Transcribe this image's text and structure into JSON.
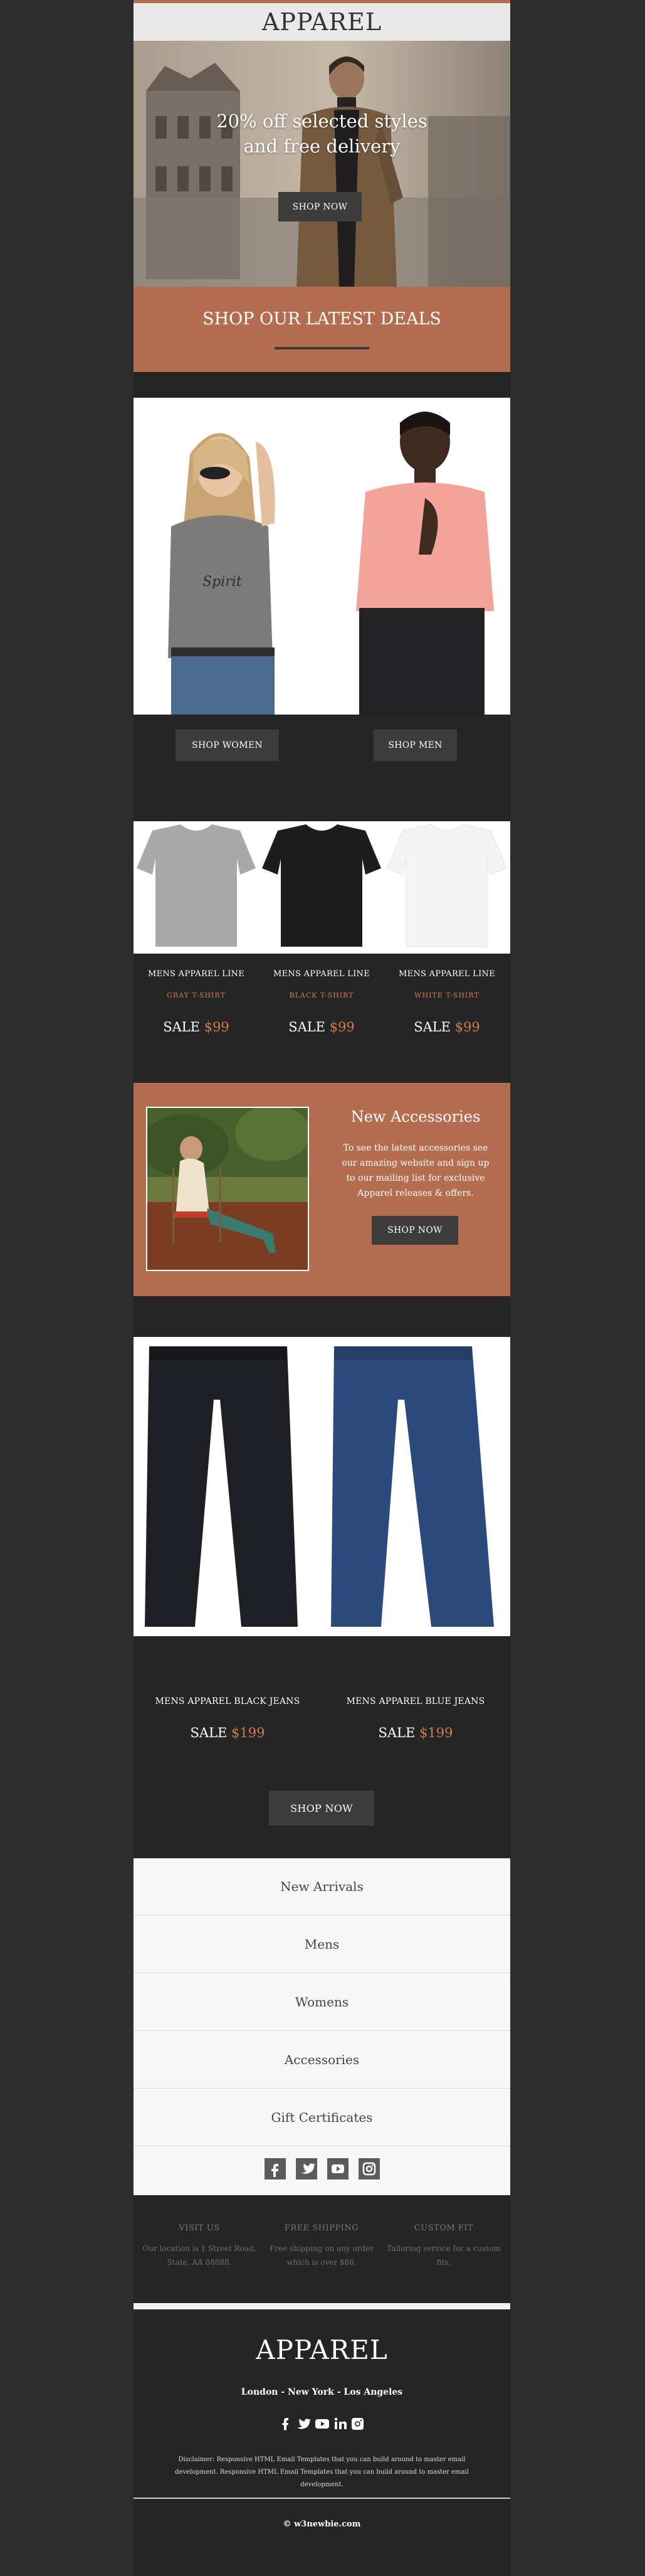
{
  "header": {
    "logo": "APPAREL"
  },
  "hero": {
    "headline_line1": "20% off selected styles",
    "headline_line2": "and free delivery",
    "cta": "SHOP NOW",
    "banner": "SHOP OUR LATEST DEALS"
  },
  "gender": {
    "women_cta": "SHOP WOMEN",
    "men_cta": "SHOP MEN"
  },
  "tshirts": [
    {
      "line": "MENS APPAREL LINE",
      "name": "GRAY T-SHIRT",
      "sale_label": "SALE",
      "price": "$99"
    },
    {
      "line": "MENS APPAREL LINE",
      "name": "BLACK T-SHIRT",
      "sale_label": "SALE",
      "price": "$99"
    },
    {
      "line": "MENS APPAREL LINE",
      "name": "WHITE T-SHIRT",
      "sale_label": "SALE",
      "price": "$99"
    }
  ],
  "accessories": {
    "title": "New Accessories",
    "body": "To see the latest accessories see our amazing website and sign up to our mailing list for exclusive Apparel releases & offers.",
    "cta": "SHOP NOW"
  },
  "jeans": [
    {
      "name": "MENS APPAREL BLACK JEANS",
      "sale_label": "SALE",
      "price": "$199"
    },
    {
      "name": "MENS APPAREL BLUE JEANS",
      "sale_label": "SALE",
      "price": "$199"
    }
  ],
  "jeans_cta": "SHOP NOW",
  "menu": [
    "New Arrivals",
    "Mens",
    "Womens",
    "Accessories",
    "Gift Certificates"
  ],
  "social_icons": [
    "facebook-icon",
    "twitter-icon",
    "youtube-icon",
    "instagram-icon"
  ],
  "info": [
    {
      "title": "VISIT US",
      "text": "Our location is 1 Street Road, State, AA 88888."
    },
    {
      "title": "FREE SHIPPING",
      "text": "Free shipping on any order which is over $88."
    },
    {
      "title": "CUSTOM FIT",
      "text": "Tailoring service for a custom fits."
    }
  ],
  "footer": {
    "logo": "APPAREL",
    "cities": "London - New York - Los Angeles",
    "disclaimer": "Disclaimer: Responsive HTML Email Templates that you can build around to master email development. Responsive HTML Email Templates that you can build around to master email development.",
    "copyright": "© w3newbie.com"
  },
  "colors": {
    "accent": "#b46d4e",
    "price": "#d07a4f",
    "dark": "#252525",
    "button": "#3c3c3c"
  }
}
